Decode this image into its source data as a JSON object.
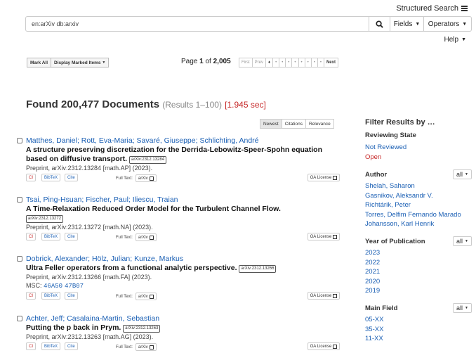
{
  "header": {
    "structured_search": "Structured Search",
    "search_value": "en:arXiv db:arxiv",
    "fields_label": "Fields",
    "operators_label": "Operators",
    "help_label": "Help"
  },
  "toolbar": {
    "mark_all": "Mark All",
    "display_marked": "Display Marked Items",
    "page_prefix": "Page",
    "page_current": "1",
    "page_of": "of",
    "page_total": "2,005",
    "first": "First",
    "prev": "Prev",
    "next": "Next"
  },
  "summary": {
    "found": "Found 200,477 Documents",
    "range": "(Results 1–100)",
    "time": "[1.945 sec]"
  },
  "sort": {
    "newest": "Newest",
    "citations": "Citations",
    "relevance": "Relevance"
  },
  "results": [
    {
      "authors": "Matthes, Daniel; Rott, Eva-Maria; Savaré, Giuseppe; Schlichting, André",
      "title": "A structure preserving discretization for the Derrida-Lebowitz-Speer-Spohn equation based on diffusive transport.",
      "tag": "arXiv:2312.13284",
      "pub": "Preprint, arXiv:2312.13284 [math.AP] (2023).",
      "cl": "CI",
      "bibtex": "BibTeX",
      "cite": "Cite",
      "fulltext": "Full Text:",
      "ft_btn": "arXiv",
      "oa": "OA License"
    },
    {
      "authors": "Tsai, Ping-Hsuan; Fischer, Paul; Iliescu, Traian",
      "title": "A Time-Relaxation Reduced Order Model for the Turbulent Channel Flow.",
      "tag": "arXiv:2312.13272",
      "pub": "Preprint, arXiv:2312.13272 [math.NA] (2023).",
      "cl": "CI",
      "bibtex": "BibTeX",
      "cite": "Cite",
      "fulltext": "Full Text:",
      "ft_btn": "arXiv",
      "oa": "OA License"
    },
    {
      "authors": "Dobrick, Alexander; Hölz, Julian; Kunze, Markus",
      "title": "Ultra Feller operators from a functional analytic perspective.",
      "tag": "arXiv:2312.13266",
      "pub": "Preprint, arXiv:2312.13266 [math.FA] (2023).",
      "msc_label": "MSC:",
      "msc_codes": [
        "46A50",
        "47B07"
      ],
      "cl": "CI",
      "bibtex": "BibTeX",
      "cite": "Cite",
      "fulltext": "Full Text:",
      "ft_btn": "arXiv",
      "oa": "OA License"
    },
    {
      "authors": "Achter, Jeff; Casalaina-Martin, Sebastian",
      "title": "Putting the p back in Prym.",
      "tag": "arXiv:2312.13263",
      "pub": "Preprint, arXiv:2312.13263 [math.AG] (2023).",
      "cl": "CI",
      "bibtex": "BibTeX",
      "cite": "Cite",
      "fulltext": "Full Text:",
      "ft_btn": "arXiv",
      "oa": "OA License"
    }
  ],
  "filters": {
    "title": "Filter Results by …",
    "reviewing": {
      "head": "Reviewing State",
      "items": [
        "Not Reviewed",
        "Open"
      ]
    },
    "author": {
      "head": "Author",
      "all": "all",
      "items": [
        "Shelah, Saharon",
        "Gasnikov, Aleksandr V.",
        "Richtárik, Peter",
        "Torres, Delfim Fernando Marado",
        "Johansson, Karl Henrik"
      ]
    },
    "year": {
      "head": "Year of Publication",
      "all": "all",
      "items": [
        "2023",
        "2022",
        "2021",
        "2020",
        "2019"
      ]
    },
    "field": {
      "head": "Main Field",
      "all": "all",
      "items": [
        "05-XX",
        "35-XX",
        "11-XX"
      ]
    }
  },
  "colors": {
    "link": "#1a5fb4",
    "time": "#c62828",
    "open": "#c62828"
  },
  "icons": [
    "list-icon",
    "search-icon",
    "caret-down-icon",
    "external-link-icon"
  ]
}
